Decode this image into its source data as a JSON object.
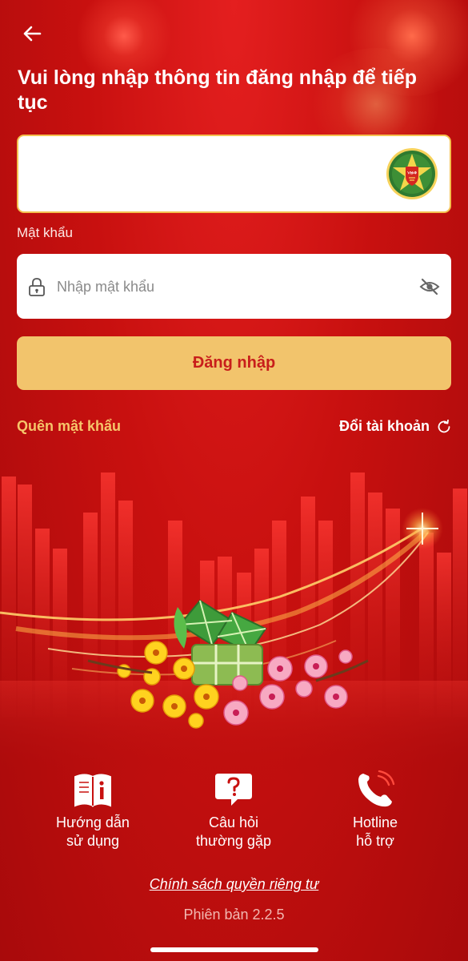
{
  "header": {
    "title": "Vui lòng nhập thông tin đăng nhập để tiếp tục"
  },
  "account_field": {
    "value": "",
    "logo_icon": "vneid-logo"
  },
  "password": {
    "label": "Mật khẩu",
    "placeholder": "Nhập mật khẩu",
    "leading_icon": "lock-icon",
    "trailing_icon": "eye-off-icon"
  },
  "login_button": {
    "label": "Đăng nhập"
  },
  "actions": {
    "forgot_password": "Quên mật khẩu",
    "switch_account": "Đổi tài khoản"
  },
  "quick_links": [
    {
      "line1": "Hướng dẫn",
      "line2": "sử dụng",
      "icon": "book-info-icon"
    },
    {
      "line1": "Câu hỏi",
      "line2": "thường gặp",
      "icon": "question-bubble-icon"
    },
    {
      "line1": "Hotline",
      "line2": "hỗ trợ",
      "icon": "phone-icon"
    }
  ],
  "footer": {
    "privacy_policy": "Chính sách quyền riêng tư",
    "version": "Phiên bản 2.2.5"
  },
  "colors": {
    "background": "#c8100f",
    "accent_gold": "#f2c46c",
    "button_text": "#c81e1b",
    "forgot_link": "#f6c56a"
  }
}
